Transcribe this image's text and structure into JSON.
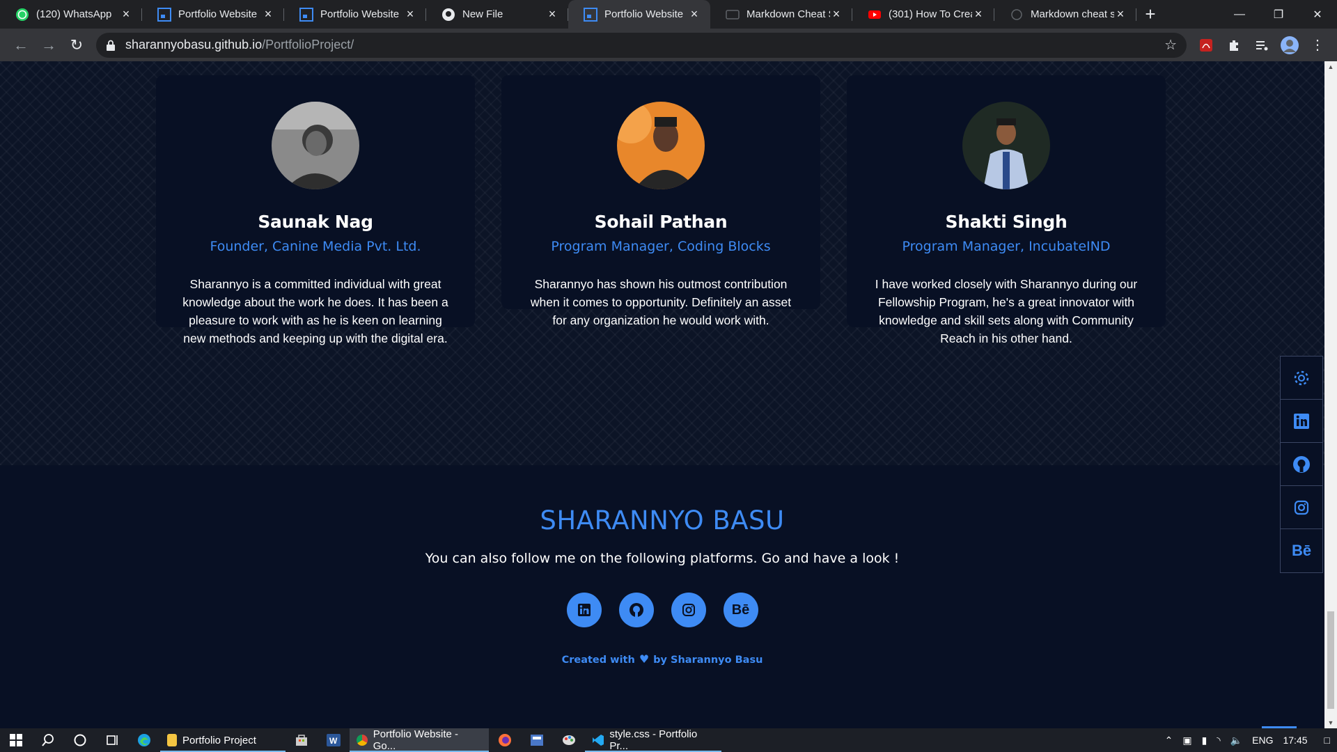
{
  "browser": {
    "tabs": [
      {
        "title": "(120) WhatsApp",
        "icon": "whatsapp-icon",
        "active": false
      },
      {
        "title": "Portfolio Website",
        "icon": "portfolio-icon",
        "active": false
      },
      {
        "title": "Portfolio Website",
        "icon": "portfolio-icon",
        "active": false
      },
      {
        "title": "New File",
        "icon": "github-icon",
        "active": false
      },
      {
        "title": "Portfolio Website",
        "icon": "portfolio-icon",
        "active": true
      },
      {
        "title": "Markdown Cheat S",
        "icon": "markdown-icon",
        "active": false
      },
      {
        "title": "(301) How To Crea",
        "icon": "youtube-icon",
        "active": false
      },
      {
        "title": "Markdown cheat s",
        "icon": "markdown-icon",
        "active": false
      }
    ],
    "url_domain": "sharannyobasu.github.io",
    "url_path": "/PortfolioProject/"
  },
  "testimonials": [
    {
      "name": "Saunak Nag",
      "role": "Founder, Canine Media Pvt. Ltd.",
      "text": "Sharannyo is a committed individual with great knowledge about the work he does. It has been a pleasure to work with as he is keen on learning new methods and keeping up with the digital era."
    },
    {
      "name": "Sohail Pathan",
      "role": "Program Manager, Coding Blocks",
      "text": "Sharannyo has shown his outmost contribution when it comes to opportunity. Definitely an asset for any organization he would work with."
    },
    {
      "name": "Shakti Singh",
      "role": "Program Manager, IncubateIND",
      "text": "I have worked closely with Sharannyo during our Fellowship Program, he's a great innovator with knowledge and skill sets along with Community Reach in his other hand."
    }
  ],
  "footer": {
    "title": "SHARANNYO BASU",
    "follow_text": "You can also follow me on the following platforms. Go and have a look !",
    "social": [
      "linkedin-icon",
      "github-icon",
      "instagram-icon",
      "behance-icon"
    ],
    "behance_label": "Bē",
    "credit_before": "Created with",
    "credit_after": "by Sharannyo Basu"
  },
  "sidebar": {
    "items": [
      "gear-icon",
      "linkedin-icon",
      "github-icon",
      "instagram-icon",
      "behance-icon"
    ],
    "behance_label": "Bē"
  },
  "taskbar": {
    "apps": [
      {
        "label": "Portfolio Project",
        "icon": "folder-icon"
      },
      {
        "label": "Portfolio Website - Go...",
        "icon": "chrome-icon"
      },
      {
        "label": "style.css - Portfolio Pr...",
        "icon": "vscode-icon"
      }
    ],
    "language": "ENG",
    "time": "17:45"
  },
  "colors": {
    "accent": "#3e8bf4",
    "background": "#0a1122",
    "card": "#081024"
  }
}
